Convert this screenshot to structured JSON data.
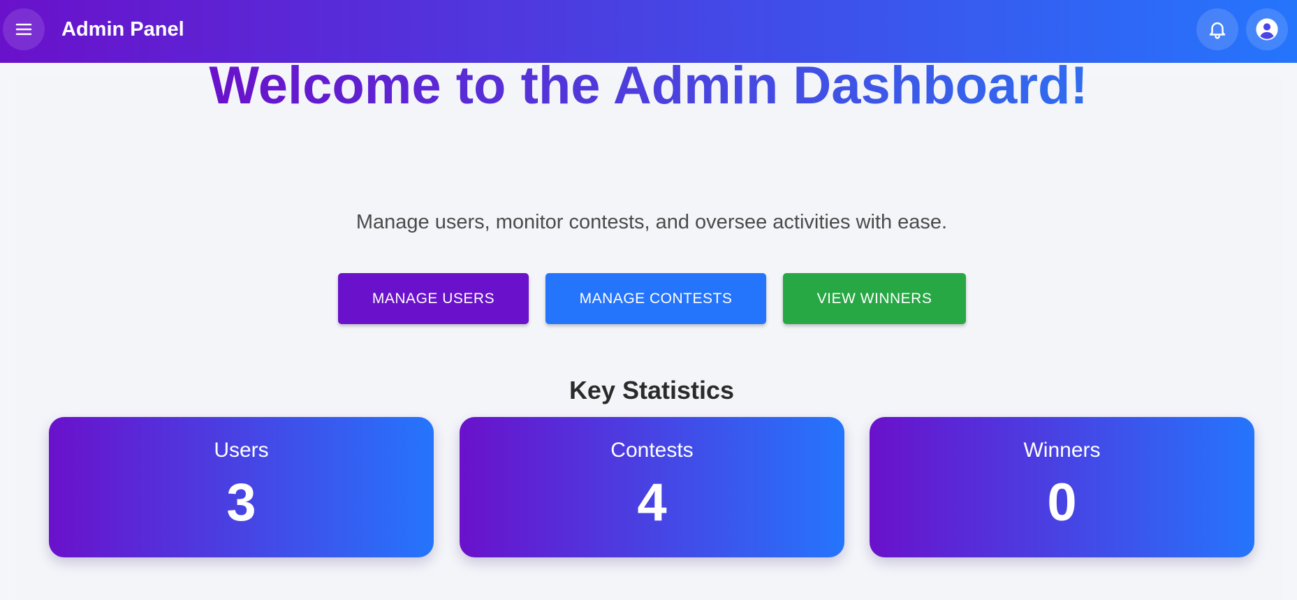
{
  "header": {
    "title": "Admin Panel",
    "menu_icon": "hamburger-menu-icon",
    "notification_icon": "bell-icon",
    "account_icon": "account-circle-icon",
    "gradient": [
      "#6a11cb",
      "#2575fc"
    ]
  },
  "hero": {
    "title": "Welcome to the Admin Dashboard!",
    "subtitle": "Manage users, monitor contests, and oversee activities with ease."
  },
  "actions": {
    "manage_users": "MANAGE USERS",
    "manage_contests": "MANAGE CONTESTS",
    "view_winners": "VIEW WINNERS",
    "colors": {
      "manage_users": "#6a11cb",
      "manage_contests": "#2575fc",
      "view_winners": "#28a745"
    }
  },
  "statistics": {
    "heading": "Key Statistics",
    "cards": [
      {
        "label": "Users",
        "value": "3"
      },
      {
        "label": "Contests",
        "value": "4"
      },
      {
        "label": "Winners",
        "value": "0"
      }
    ]
  }
}
